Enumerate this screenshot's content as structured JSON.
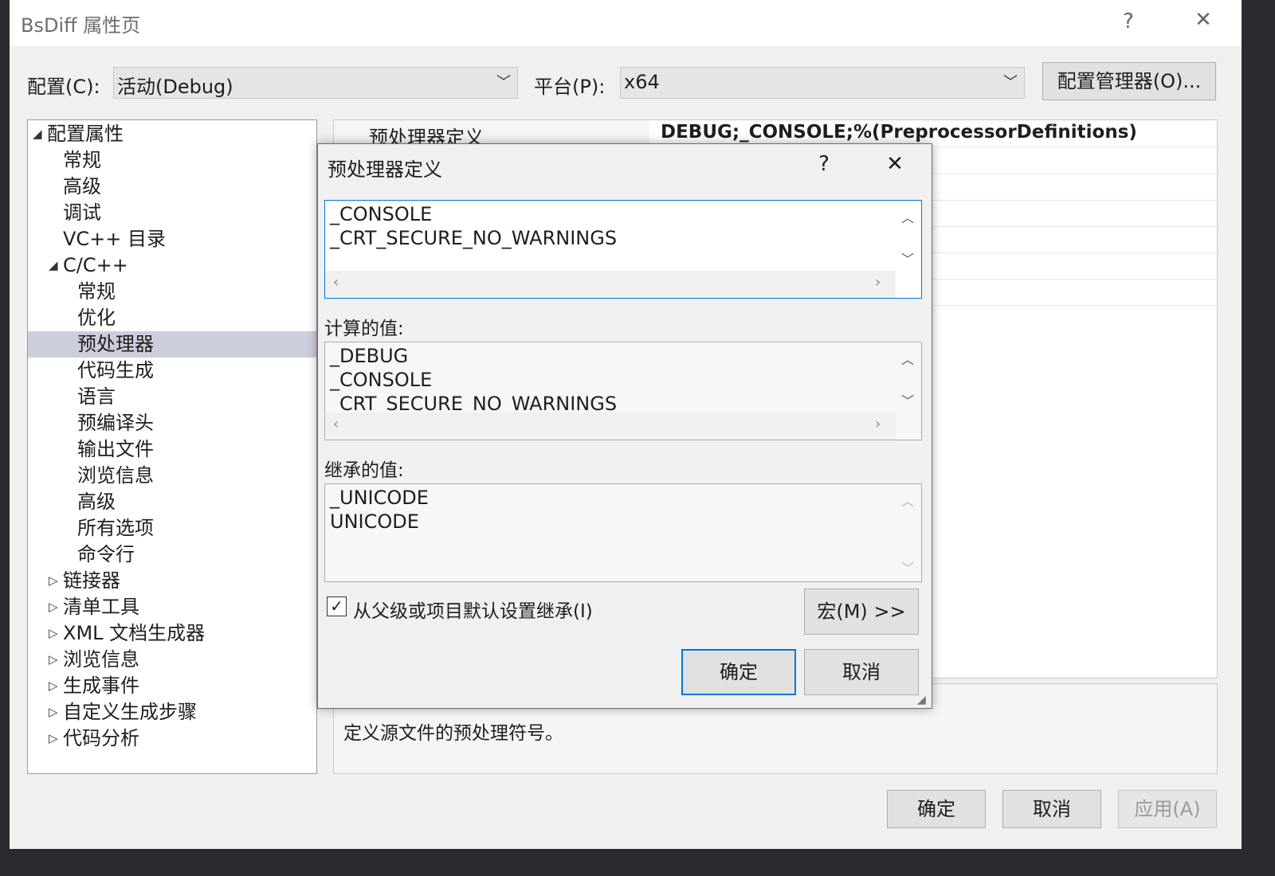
{
  "window": {
    "title": "BsDiff 属性页",
    "help": "?",
    "close": "✕"
  },
  "toolbar": {
    "config_label": "配置(C):",
    "config_value": "活动(Debug)",
    "platform_label": "平台(P):",
    "platform_value": "x64",
    "config_manager": "配置管理器(O)..."
  },
  "tree": {
    "items": [
      {
        "label": "配置属性",
        "expander": "◢"
      },
      {
        "label": "常规"
      },
      {
        "label": "高级"
      },
      {
        "label": "调试"
      },
      {
        "label": "VC++ 目录"
      },
      {
        "label": "C/C++",
        "expander": "◢"
      },
      {
        "label": "常规"
      },
      {
        "label": "优化"
      },
      {
        "label": "预处理器"
      },
      {
        "label": "代码生成"
      },
      {
        "label": "语言"
      },
      {
        "label": "预编译头"
      },
      {
        "label": "输出文件"
      },
      {
        "label": "浏览信息"
      },
      {
        "label": "高级"
      },
      {
        "label": "所有选项"
      },
      {
        "label": "命令行"
      },
      {
        "label": "链接器",
        "expander": "▷"
      },
      {
        "label": "清单工具",
        "expander": "▷"
      },
      {
        "label": "XML 文档生成器",
        "expander": "▷"
      },
      {
        "label": "浏览信息",
        "expander": "▷"
      },
      {
        "label": "生成事件",
        "expander": "▷"
      },
      {
        "label": "自定义生成步骤",
        "expander": "▷"
      },
      {
        "label": "代码分析",
        "expander": "▷"
      }
    ]
  },
  "grid": {
    "first_row_name": "预处理器定义",
    "first_row_value": "DEBUG;_CONSOLE;%(PreprocessorDefinitions)"
  },
  "description": {
    "text": "定义源文件的预处理符号。"
  },
  "dialog": {
    "title": "预处理器定义",
    "help": "?",
    "close": "✕",
    "edit_text": "_CONSOLE\n_CRT_SECURE_NO_WARNINGS",
    "computed_label": "计算的值:",
    "computed_text": "_DEBUG\n_CONSOLE\n_CRT_SECURE_NO_WARNINGS",
    "inherited_label": "继承的值:",
    "inherited_text": "_UNICODE\nUNICODE",
    "inherit_checkbox": "从父级或项目默认设置继承(I)",
    "inherit_checked": "✓",
    "macro_button": "宏(M) >>",
    "ok": "确定",
    "cancel": "取消"
  },
  "footer": {
    "ok": "确定",
    "cancel": "取消",
    "apply": "应用(A)"
  },
  "colors": {
    "accent": "#0078d7",
    "selection": "#cccedb"
  }
}
